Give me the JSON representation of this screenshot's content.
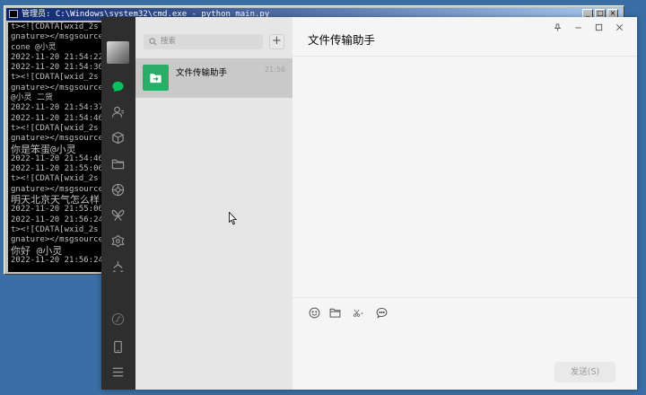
{
  "cmd": {
    "title": "管理员: C:\\Windows\\system32\\cmd.exe - python  main.py",
    "buttons": [
      "_",
      "□",
      "×"
    ],
    "lines": [
      {
        "text": "t><![CDATA[wxid_2s",
        "big": false
      },
      {
        "text": "gnature></msgsource",
        "big": false
      },
      {
        "text": "cone @小灵",
        "big": false
      },
      {
        "text": "2022-11-20 21:54:22",
        "big": false
      },
      {
        "text": "2022-11-20 21:54:36",
        "big": false
      },
      {
        "text": "t><![CDATA[wxid_2s",
        "big": false
      },
      {
        "text": "gnature></msgsource",
        "big": false
      },
      {
        "text": "@小灵 二货",
        "big": false
      },
      {
        "text": "2022-11-20 21:54:37",
        "big": false
      },
      {
        "text": "2022-11-20 21:54:46",
        "big": false
      },
      {
        "text": "t><![CDATA[wxid_2s",
        "big": false
      },
      {
        "text": "gnature></msgsource",
        "big": false
      },
      {
        "text": "你是笨蛋@小灵",
        "big": true
      },
      {
        "text": "2022-11-20 21:54:46",
        "big": false
      },
      {
        "text": "2022-11-20 21:55:06",
        "big": false
      },
      {
        "text": "t><![CDATA[wxid_2s",
        "big": false
      },
      {
        "text": "gnature></msgsource",
        "big": false
      },
      {
        "text": "明天北京天气怎么样",
        "big": true
      },
      {
        "text": "2022-11-20 21:55:06",
        "big": false
      },
      {
        "text": "2022-11-20 21:56:24",
        "big": false
      },
      {
        "text": "t><![CDATA[wxid_2s",
        "big": false
      },
      {
        "text": "gnature></msgsource",
        "big": false
      },
      {
        "text": "你好 @小灵",
        "big": true
      },
      {
        "text": "2022-11-20 21:56:24",
        "big": false
      }
    ]
  },
  "wechat": {
    "search_placeholder": "搜索",
    "add_button": "+",
    "chats": [
      {
        "name": "文件传输助手",
        "time": "21:56"
      }
    ],
    "chat_title": "文件传输助手",
    "send_label": "发送(S)"
  },
  "colors": {
    "desktop": "#3a6ea5",
    "sidebar": "#2e2e2e",
    "chat_list": "#e6e6e6",
    "selected_chat": "#c9c9c9",
    "active_nav": "#07c160",
    "file_helper": "#2aae67"
  }
}
